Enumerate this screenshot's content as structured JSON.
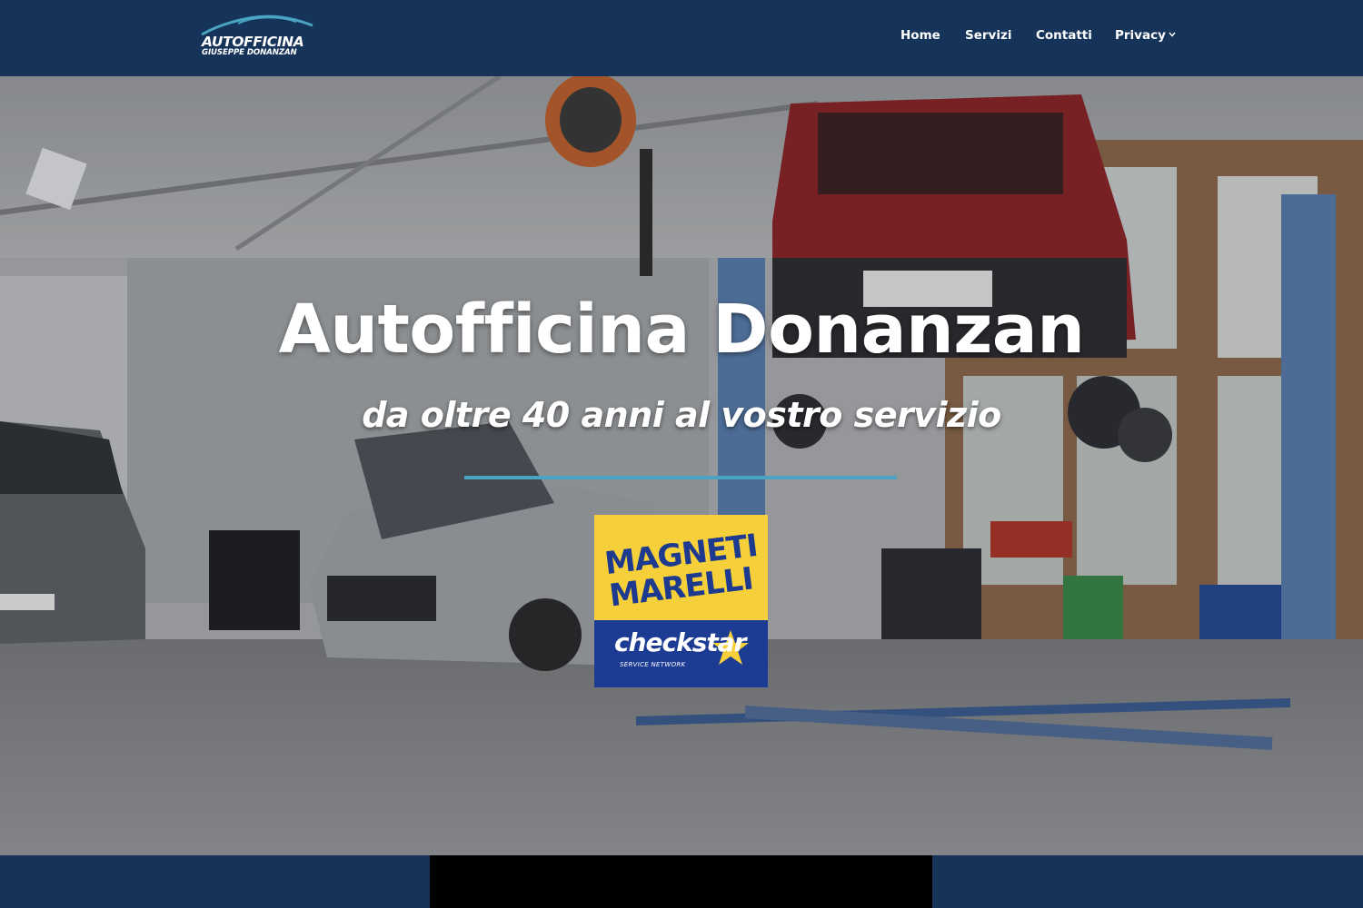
{
  "brand": {
    "line1": "AUTOFFICINA",
    "line2": "GIUSEPPE DONANZAN",
    "icon": "car-silhouette-icon"
  },
  "nav": {
    "home": "Home",
    "servizi": "Servizi",
    "contatti": "Contatti",
    "privacy": "Privacy",
    "privacy_icon": "chevron-down-icon"
  },
  "hero": {
    "title": "Autofficina Donanzan",
    "subtitle": "da oltre 40 anni al vostro servizio"
  },
  "badge": {
    "line1": "MAGNETI",
    "line2": "MARELLI",
    "brand2": "checkstar",
    "tagline": "SERVICE NETWORK",
    "star_icon": "star-icon"
  },
  "colors": {
    "navbar": "#16345a",
    "accent": "#4aa3c1",
    "badge_yellow": "#f6d03a",
    "badge_blue": "#1c3b93"
  }
}
